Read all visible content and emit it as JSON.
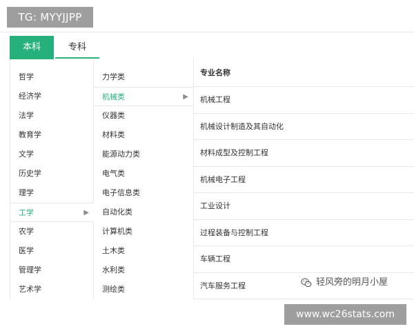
{
  "tg_badge": "TG: MYYJJPP",
  "tabs": [
    {
      "label": "本科",
      "active": true
    },
    {
      "label": "专科",
      "active": false
    }
  ],
  "disciplines": [
    "哲学",
    "经济学",
    "法学",
    "教育学",
    "文学",
    "历史学",
    "理学",
    "工学",
    "农学",
    "医学",
    "管理学",
    "艺术学"
  ],
  "selected_discipline": "工学",
  "categories": [
    "力学类",
    "机械类",
    "仪器类",
    "材料类",
    "能源动力类",
    "电气类",
    "电子信息类",
    "自动化类",
    "计算机类",
    "土木类",
    "水利类",
    "测绘类"
  ],
  "selected_category": "机械类",
  "majors_header": "专业名称",
  "majors": [
    "机械工程",
    "机械设计制造及其自动化",
    "材料成型及控制工程",
    "机械电子工程",
    "工业设计",
    "过程装备与控制工程",
    "车辆工程",
    "汽车服务工程"
  ],
  "watermark": "轻风旁的明月小屋",
  "site_badge": "www.wc26stats.com",
  "colors": {
    "accent": "#26b17c",
    "badge_bg": "#9e9e9e",
    "border": "#e6e6e6"
  }
}
